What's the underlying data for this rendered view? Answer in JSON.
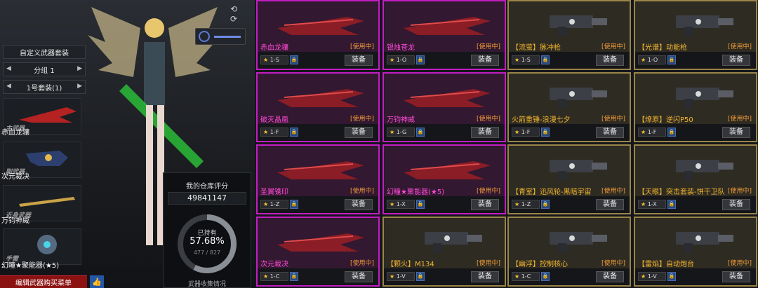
{
  "left": {
    "custom_set_label": "自定义武器套装",
    "group_label": "分组 1",
    "set_label": "1号套装(1)",
    "slots": [
      {
        "category": "主武器",
        "name": "赤血龙骧"
      },
      {
        "category": "副武器",
        "name": "次元裁决"
      },
      {
        "category": "近身武器",
        "name": "万钧神威"
      },
      {
        "category": "手雷",
        "name": "幻瞳★聚能器(★5)"
      }
    ],
    "edit_button": "编辑武器购买菜单",
    "thumb_icon": "thumbs-up-icon"
  },
  "score": {
    "label": "我的仓库评分",
    "value": "49841147",
    "owned_label": "已持有",
    "percent": "57.68%",
    "percent_value": 57.68,
    "ratio": "477 / 827",
    "collect_label": "武器收集情况"
  },
  "cards": [
    {
      "name": "赤血龙骧",
      "status": "[使用中]",
      "level": "1-S",
      "equip": "装备",
      "theme": "pink",
      "locked": true
    },
    {
      "name": "银烛苍龙",
      "status": "[使用中]",
      "level": "1-O",
      "equip": "装备",
      "theme": "pink",
      "locked": true
    },
    {
      "name": "【流萤】脉冲枪",
      "status": "[使用中]",
      "level": "1-S",
      "equip": "装备",
      "theme": "gold",
      "locked": true
    },
    {
      "name": "【光谱】动能枪",
      "status": "[使用中]",
      "level": "1-O",
      "equip": "装备",
      "theme": "gold",
      "locked": true
    },
    {
      "name": "破灭晶凰",
      "status": "[使用中]",
      "level": "1-F",
      "equip": "装备",
      "theme": "pink",
      "locked": true
    },
    {
      "name": "万钧神威",
      "status": "[使用中]",
      "level": "1-G",
      "equip": "装备",
      "theme": "pink",
      "locked": true
    },
    {
      "name": "火箭重锤-浪漫七夕",
      "status": "[使用中]",
      "level": "1-F",
      "equip": "装备",
      "theme": "gold",
      "locked": true
    },
    {
      "name": "【燎原】逆闪P50",
      "status": "[使用中]",
      "level": "1-F",
      "equip": "装备",
      "theme": "gold",
      "locked": true
    },
    {
      "name": "圣翼镌印",
      "status": "[使用中]",
      "level": "1-Z",
      "equip": "装备",
      "theme": "pink",
      "locked": true
    },
    {
      "name": "幻瞳★聚能器(★5)",
      "status": "[使用中]",
      "level": "1-X",
      "equip": "装备",
      "theme": "pink",
      "locked": false
    },
    {
      "name": "【青室】迅风轮-黑暗宇宙",
      "status": "[使用中]",
      "level": "1-Z",
      "equip": "装备",
      "theme": "gold",
      "locked": true
    },
    {
      "name": "【天眼】突击套装-饼干卫队",
      "status": "[使用中]",
      "level": "1-X",
      "equip": "装备",
      "theme": "gold",
      "locked": true
    },
    {
      "name": "次元裁决",
      "status": "[使用中]",
      "level": "1-C",
      "equip": "装备",
      "theme": "pink",
      "locked": false
    },
    {
      "name": "【颗火】M134",
      "status": "[使用中]",
      "level": "1-V",
      "equip": "装备",
      "theme": "gold",
      "locked": true
    },
    {
      "name": "【幽浮】控制核心",
      "status": "[使用中]",
      "level": "1-C",
      "equip": "装备",
      "theme": "gold",
      "locked": true
    },
    {
      "name": "【雷焰】自动炮台",
      "status": "[使用中]",
      "level": "1-V",
      "equip": "装备",
      "theme": "gold",
      "locked": true
    }
  ],
  "colors": {
    "pink_border": "#c31dc3",
    "gold_border": "#9a8548",
    "status_orange": "#f39c3a",
    "edit_red": "#8c1212"
  }
}
